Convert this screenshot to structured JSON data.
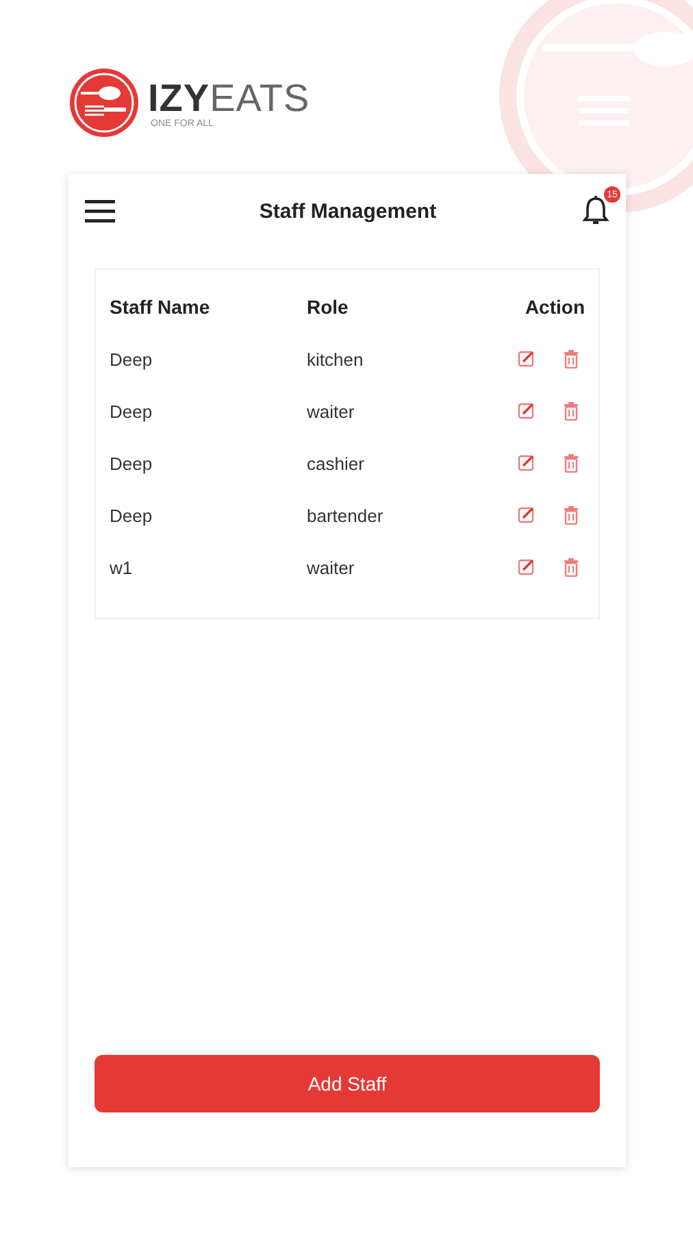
{
  "brand": {
    "name_bold": "IZY",
    "name_light": "EATS",
    "tagline": "ONE FOR ALL"
  },
  "header": {
    "title": "Staff Management",
    "notification_count": "15"
  },
  "table": {
    "columns": [
      "Staff Name",
      "Role",
      "Action"
    ],
    "rows": [
      {
        "name": "Deep",
        "role": "kitchen"
      },
      {
        "name": "Deep",
        "role": "waiter"
      },
      {
        "name": "Deep",
        "role": "cashier"
      },
      {
        "name": "Deep",
        "role": "bartender"
      },
      {
        "name": "w1",
        "role": "waiter"
      }
    ]
  },
  "add_button": "Add Staff"
}
